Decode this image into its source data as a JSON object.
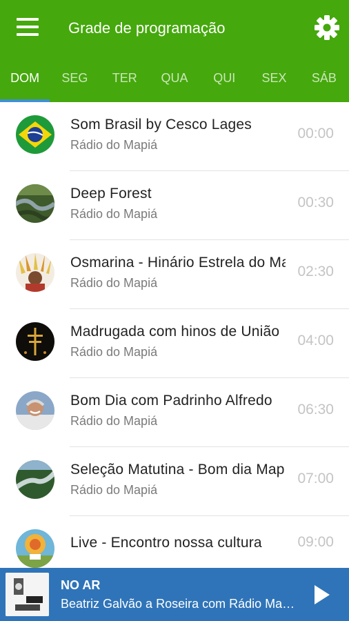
{
  "header": {
    "title": "Grade de programação",
    "menu_icon": "menu-icon",
    "settings_icon": "gear-icon"
  },
  "tabs": [
    {
      "label": "DOM",
      "active": true
    },
    {
      "label": "SEG",
      "active": false
    },
    {
      "label": "TER",
      "active": false
    },
    {
      "label": "QUA",
      "active": false
    },
    {
      "label": "QUI",
      "active": false
    },
    {
      "label": "SEX",
      "active": false
    },
    {
      "label": "SÁB",
      "active": false
    }
  ],
  "schedule": [
    {
      "title": "Som Brasil by Cesco Lages",
      "station": "Rádio do Mapiá",
      "time": "00:00",
      "icon": "brazil-flag-avatar"
    },
    {
      "title": "Deep Forest",
      "station": "Rádio do Mapiá",
      "time": "00:30",
      "icon": "forest-river-avatar"
    },
    {
      "title": "Osmarina - Hinário Estrela do Mar",
      "station": "Rádio do Mapiá",
      "time": "02:30",
      "icon": "feather-headdress-avatar"
    },
    {
      "title": "Madrugada com hinos de União",
      "station": "Rádio do Mapiá",
      "time": "04:00",
      "icon": "cross-night-avatar"
    },
    {
      "title": "Bom Dia com Padrinho Alfredo",
      "station": "Rádio do Mapiá",
      "time": "06:30",
      "icon": "man-portrait-avatar"
    },
    {
      "title": "Seleção Matutina - Bom dia Mapiá",
      "station": "Rádio do Mapiá",
      "time": "07:00",
      "icon": "river-aerial-avatar"
    },
    {
      "title": "Live - Encontro nossa cultura",
      "station": "",
      "time": "09:00",
      "icon": "sun-drawing-avatar"
    }
  ],
  "player": {
    "label": "NO AR",
    "track": "Beatriz Galvão a Roseira com Rádio Mapiá",
    "thumb_icon": "radio-station-logo",
    "play_icon": "play-icon"
  },
  "colors": {
    "header_bg": "#45a80c",
    "tab_indicator": "#3f8fd6",
    "player_bg": "#2f74b8"
  }
}
